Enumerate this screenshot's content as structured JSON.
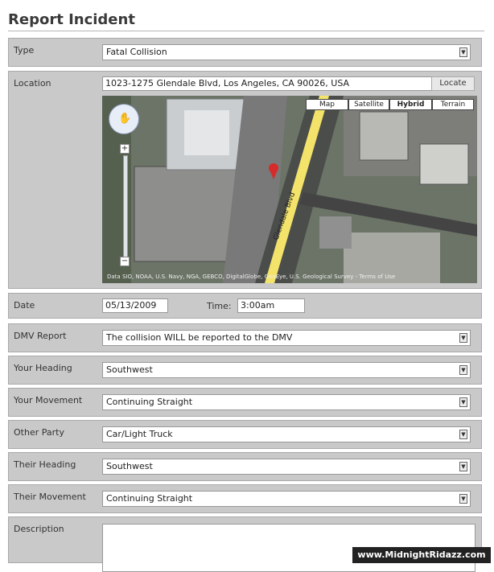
{
  "form": {
    "title": "Report Incident"
  },
  "type": {
    "label": "Type",
    "value": "Fatal Collision"
  },
  "location": {
    "label": "Location",
    "address": "1023-1275 Glendale Blvd, Los Angeles, CA 90026, USA",
    "locate_label": "Locate"
  },
  "map": {
    "types": [
      "Map",
      "Satellite",
      "Hybrid",
      "Terrain"
    ],
    "active_type": "Hybrid",
    "street_label": "Glendale Blvd",
    "credit": "Data SIO, NOAA, U.S. Navy, NGA, GEBCO, DigitalGlobe, GeoEye, U.S. Geological Survey - Terms of Use"
  },
  "date": {
    "label": "Date",
    "value": "05/13/2009",
    "time_label": "Time:",
    "time_value": "3:00am"
  },
  "dmv": {
    "label": "DMV Report",
    "value": "The collision WILL be reported to the DMV"
  },
  "your_heading": {
    "label": "Your Heading",
    "value": "Southwest"
  },
  "your_movement": {
    "label": "Your Movement",
    "value": "Continuing Straight"
  },
  "other_party": {
    "label": "Other Party",
    "value": "Car/Light Truck"
  },
  "their_heading": {
    "label": "Their Heading",
    "value": "Southwest"
  },
  "their_movement": {
    "label": "Their Movement",
    "value": "Continuing Straight"
  },
  "description": {
    "label": "Description",
    "value": ""
  },
  "watermark": "www.MidnightRidazz.com",
  "colors": {
    "row_bg": "#c9c9c9",
    "map_road": "#f3e36a",
    "pin": "#d62b2b"
  }
}
